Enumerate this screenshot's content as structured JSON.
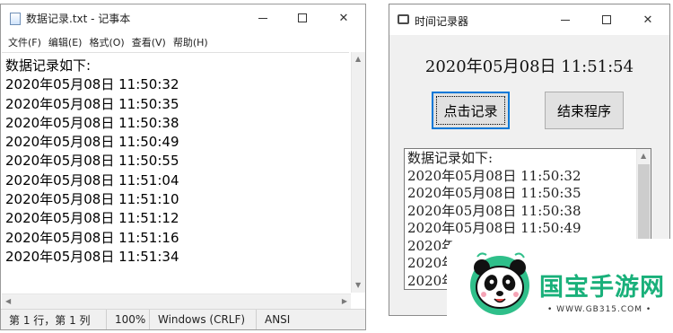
{
  "notepad": {
    "title": "数据记录.txt - 记事本",
    "menu": [
      "文件(F)",
      "编辑(E)",
      "格式(O)",
      "查看(V)",
      "帮助(H)"
    ],
    "lines": [
      "数据记录如下:",
      "2020年05月08日 11:50:32",
      "2020年05月08日 11:50:35",
      "2020年05月08日 11:50:38",
      "2020年05月08日 11:50:49",
      "2020年05月08日 11:50:55",
      "2020年05月08日 11:51:04",
      "2020年05月08日 11:51:10",
      "2020年05月08日 11:51:12",
      "2020年05月08日 11:51:16",
      "2020年05月08日 11:51:34"
    ],
    "status": {
      "position": "第 1 行，第 1 列",
      "zoom": "100%",
      "line_ending": "Windows (CRLF)",
      "encoding": "ANSI"
    }
  },
  "recorder": {
    "title": "时间记录器",
    "clock": "2020年05月08日  11:51:54",
    "record_button": "点击记录",
    "exit_button": "结束程序",
    "list_lines": [
      "数据记录如下:",
      "2020年05月08日  11:50:32",
      "2020年05月08日  11:50:35",
      "2020年05月08日  11:50:38",
      "2020年05月08日  11:50:49",
      "2020年05月08日  11:50:55",
      "2020年05月08日  11:51:04",
      "2020年05月08日  11:51:10"
    ]
  },
  "watermark": {
    "brand": "国宝手游网",
    "url": "• WWW.GB315.COM •"
  }
}
